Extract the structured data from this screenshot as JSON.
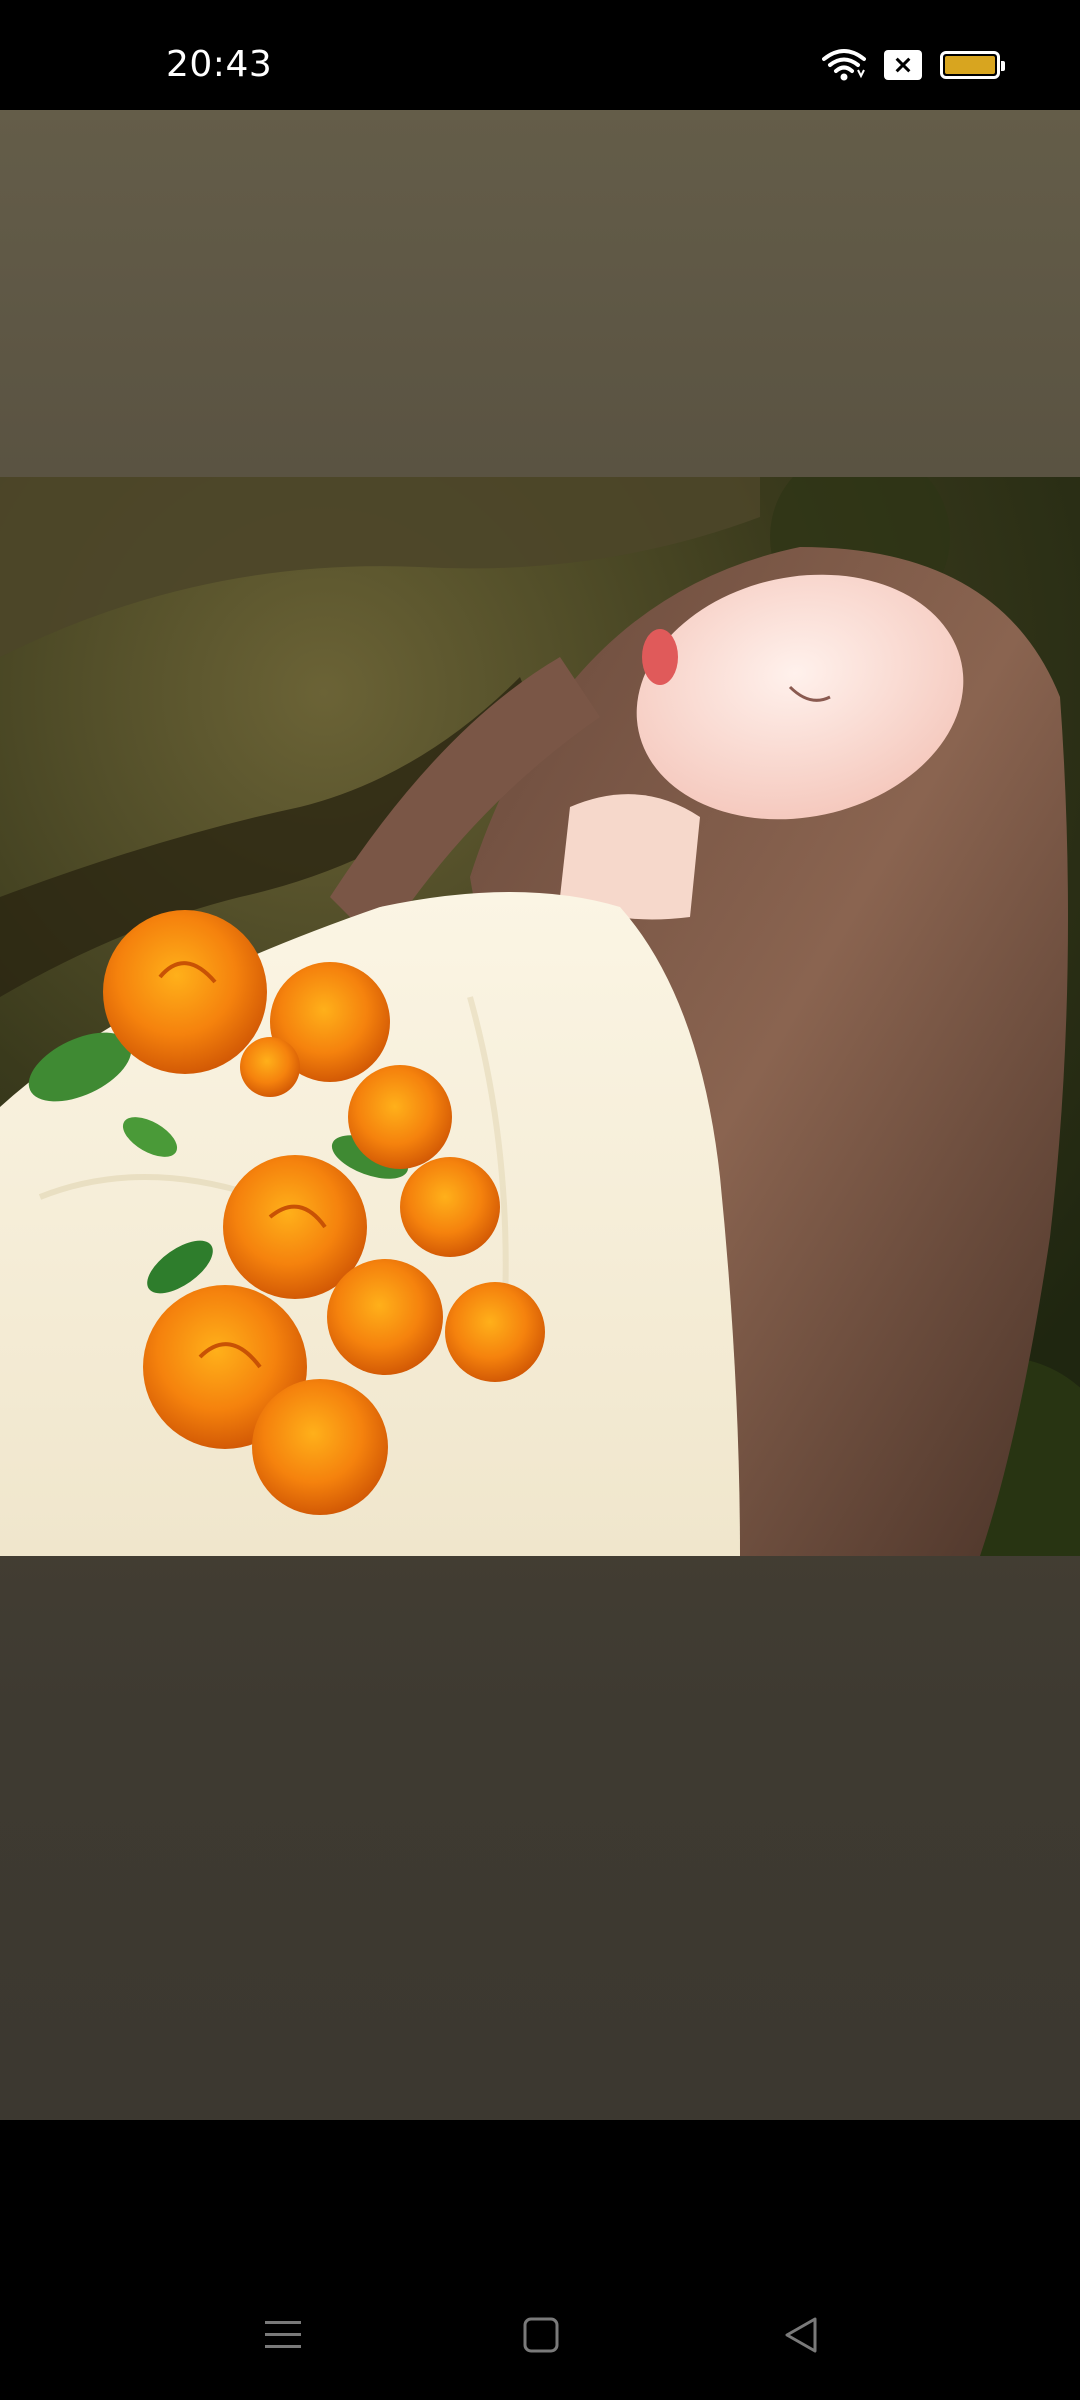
{
  "status_bar": {
    "time": "20:43",
    "icons": [
      "wifi-icon",
      "no-sim-icon",
      "battery-icon"
    ],
    "battery_color": "#d8a51f"
  },
  "viewer": {
    "background_top": "#645d49",
    "background_bottom": "#3c3830",
    "photo_description_icon": "photo"
  },
  "nav_bar": {
    "buttons": [
      "menu-icon",
      "home-icon",
      "back-icon"
    ]
  }
}
